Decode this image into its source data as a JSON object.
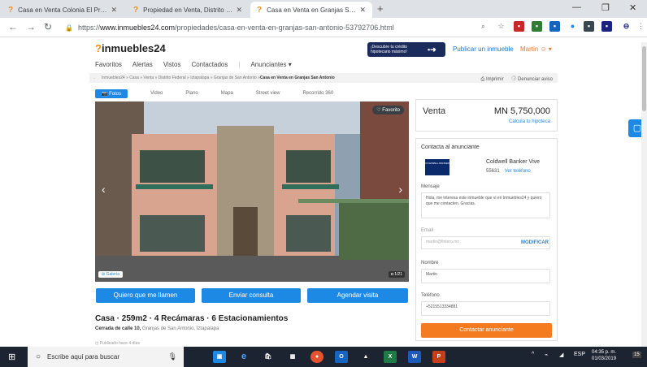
{
  "browser": {
    "tabs": [
      {
        "title": "Casa en Venta Colonia El Prado ·"
      },
      {
        "title": "Propiedad en Venta, Distrito Fed"
      },
      {
        "title": "Casa en Venta en Granjas San Ar"
      }
    ],
    "url_prefix": "https://",
    "url_host": "www.inmuebles24.com",
    "url_path": "/propiedades/casa-en-venta-en-granjas-san-antonio-53792706.html",
    "window_controls": {
      "minimize": "—",
      "maximize": "❐",
      "close": "✕"
    }
  },
  "site": {
    "logo": "inmuebles24",
    "nav": [
      "Favoritos",
      "Alertas",
      "Vistos",
      "Contactados",
      "Anunciantes ▾"
    ],
    "promo": "¡Descubre tu crédito hipotecario máximo!",
    "publish": "Publicar un inmueble",
    "user": "Martin ☺ ▾"
  },
  "breadcrumb": {
    "path": "Inmuebles24 » Casa » Venta » Distrito Federal » Iztapalapa » Granjas de San Antonio » ",
    "current": "Casa en Venta en Granjas San Antonio",
    "print": "⎙ Imprimir",
    "report": "ⓘ Denunciar aviso"
  },
  "media_tabs": [
    "📷 Fotos",
    "Video",
    "Plano",
    "Mapa",
    "Street view",
    "Recorrido 360"
  ],
  "photo": {
    "favorite": "♡ Favorito",
    "gallery": "Galería",
    "counter": "1/21"
  },
  "actions": {
    "call": "Quiero que me llamen",
    "send": "Enviar consulta",
    "schedule": "Agendar visita"
  },
  "listing": {
    "summary": "Casa · 259m2 · 4 Recámaras · 6 Estacionamientos",
    "street": "Cerrada de calle 10,",
    "area": " Granjas de San Antonio, Iztapalapa",
    "published": "Publicado hace 4 días"
  },
  "price": {
    "operation": "Venta",
    "amount": "MN 5,750,000",
    "mortgage": "Calcula tu hipoteca"
  },
  "contact": {
    "heading": "Contacta al anunciante",
    "agency_logo": "COLDWELL BANKER",
    "agency": "Coldwell Banker Vive",
    "phone": "55631",
    "view_phone": "Ver teléfono",
    "message_label": "Mensaje",
    "message": "Hola, me interesa este inmueble que vi en Inmuebles24 y quiero que me contacten. Gracias.",
    "email_label": "Email",
    "email": "martin@fintero.mx",
    "modify": "MODIFICAR",
    "name_label": "Nombre",
    "name": "Martin",
    "phone_label": "Teléfono",
    "phone_value": "+5215513334881",
    "cta": "Contactar anunciante"
  },
  "taskbar": {
    "search": "Escribe aquí para buscar",
    "lang": "ESP",
    "time": "04:35 p. m.",
    "date": "01/03/2019",
    "notifications": "15"
  },
  "colors": {
    "accent": "#1e88e5",
    "cta": "#f47b20",
    "brand": "#f08c1a"
  }
}
